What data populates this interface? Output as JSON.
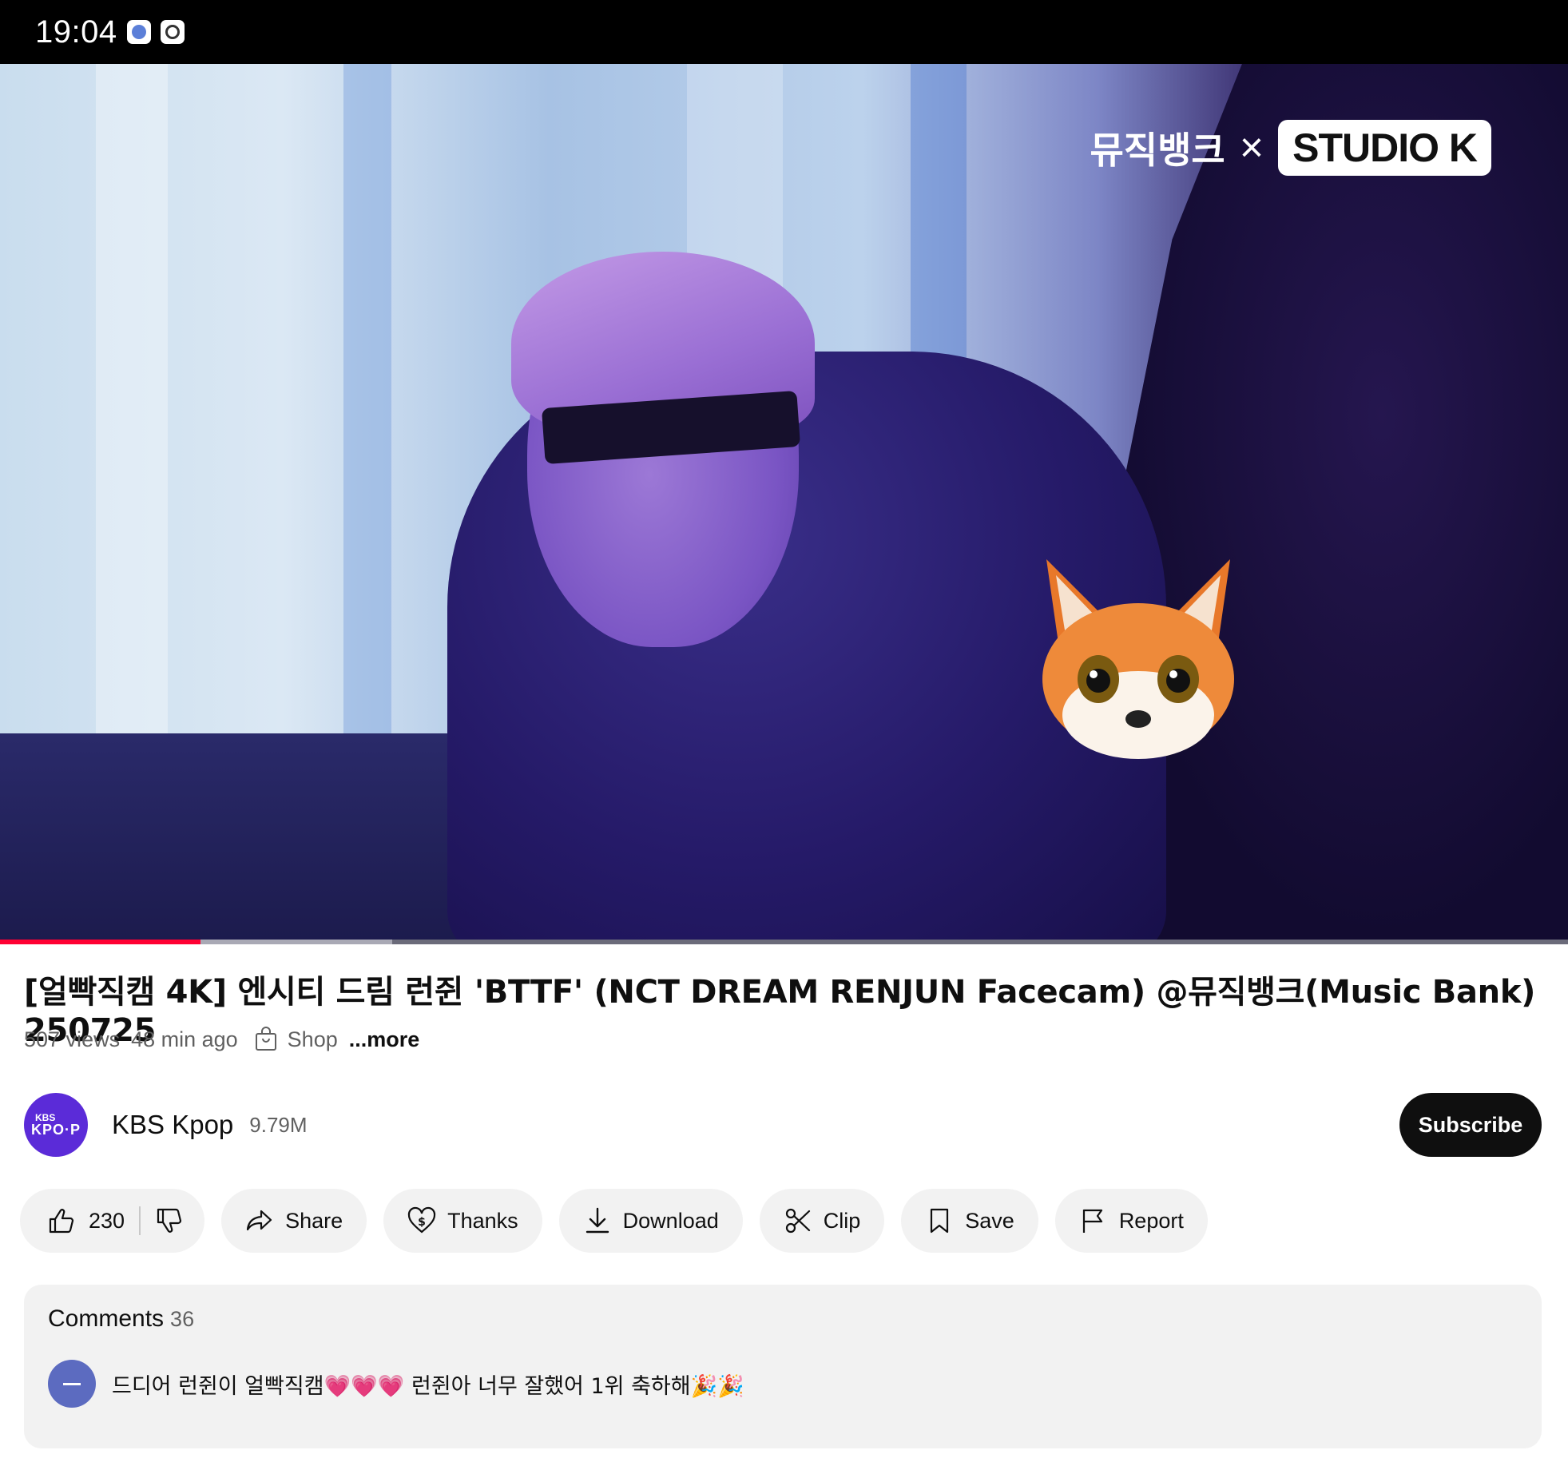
{
  "status_bar": {
    "time": "19:04",
    "icons": [
      "app-notification-icon",
      "settings-notification-icon"
    ]
  },
  "video": {
    "watermark_korean": "뮤직뱅크",
    "watermark_x": "×",
    "watermark_studio": "STUDIO K",
    "progress_played_fraction": 0.128,
    "progress_buffered_fraction": 0.25,
    "overlay": "fox-emoji",
    "colors": {
      "played": "#ff0033"
    }
  },
  "title": "[얼빡직캠 4K] 엔시티 드림 런쥔 'BTTF' (NCT DREAM RENJUN Facecam) @뮤직뱅크(Music Bank) 250725",
  "meta": {
    "views": "507 views",
    "age": "48 min ago",
    "shop": "Shop",
    "more": "...more"
  },
  "channel": {
    "avatar_line1": "KBS",
    "avatar_line2": "KPO·P",
    "name": "KBS Kpop",
    "subscribers": "9.79M",
    "subscribe_label": "Subscribe"
  },
  "actions": {
    "like_count": "230",
    "share": "Share",
    "thanks": "Thanks",
    "download": "Download",
    "clip": "Clip",
    "save": "Save",
    "report": "Report"
  },
  "comments": {
    "label": "Comments",
    "count": "36",
    "top_comment": "드디어 런쥔이 얼빡직캠💗💗💗 런쥔아 너무 잘했어 1위 축하해🎉🎉"
  }
}
